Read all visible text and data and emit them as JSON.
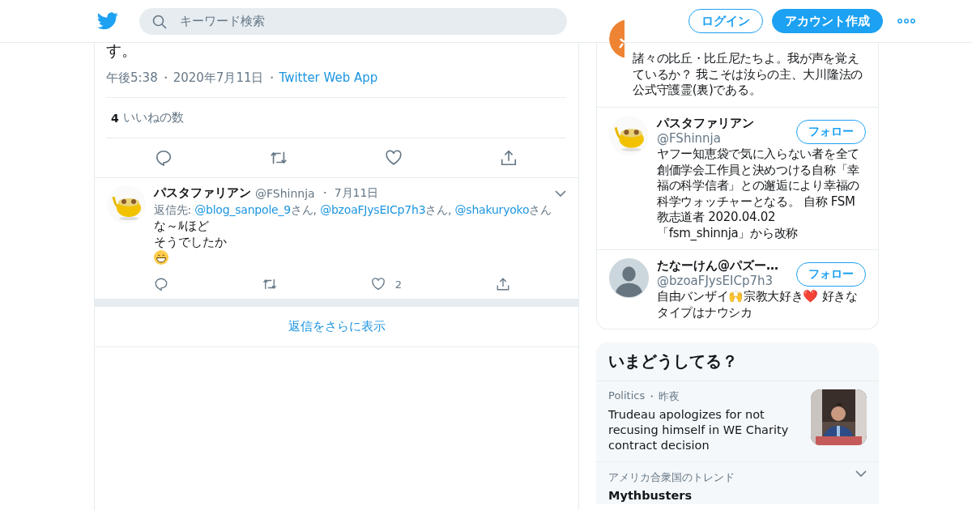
{
  "header": {
    "search": {
      "placeholder": "キーワード検索"
    },
    "login": "ログイン",
    "signup": "アカウント作成"
  },
  "tweet": {
    "text_tail": "す。",
    "time": "午後5:38",
    "separator": "・",
    "date": "2020年7月11日",
    "source": "Twitter Web App",
    "likes_count": "4",
    "likes_label": "いいねの数"
  },
  "reply": {
    "name": "パスタファリアン",
    "handle": "@FShinnja",
    "separator": "・",
    "date": "7月11日",
    "reply_to_label": "返信先:",
    "reply_to": [
      {
        "handle": "@blog_sanpole_9",
        "suffix": "さん,"
      },
      {
        "handle": "@bzoaFJysEICp7h3",
        "suffix": "さん,"
      },
      {
        "handle": "@shakuryoko",
        "suffix": "さん"
      }
    ],
    "lines": [
      "な～ﾙほど",
      "そうでしたか"
    ],
    "like_count": "2"
  },
  "show_more": "返信をさらに表示",
  "who_to_follow": [
    {
      "kind": "partial",
      "bio": "諸々の比丘・比丘尼たちよ。我が声を覚えているか？ 我こそは汝らの主、大川隆法の公式守護霊(裏)である。"
    },
    {
      "kind": "full",
      "name": "パスタファリアン",
      "handle": "@FShinnja",
      "follow": "フォロー",
      "bio": "ヤフー知恵袋で気に入らない者を全て創価学会工作員と決めつける自称「幸福の科学信者」との邂逅により幸福の科学ウォッチャーとなる。 自称 FSM教志道者 2020.04.02 「fsm_shinnja」から改称"
    },
    {
      "kind": "full",
      "avatar": {
        "kind": "default"
      },
      "name": "たなーけん@パズー…",
      "handle": "@bzoaFJysEICp7h3",
      "follow": "フォロー",
      "bio": "自由バンザイ🙌宗教大好き❤️ 好きなタイプはナウシカ"
    }
  ],
  "trends": {
    "title": "いまどうしてる？",
    "items": [
      {
        "kind": "news",
        "category": "Politics",
        "separator": "・",
        "time": "昨夜",
        "headline": "Trudeau apologizes for not recusing himself in WE Charity contract decision"
      },
      {
        "kind": "trend",
        "category": "アメリカ合衆国のトレンド",
        "name": "Mythbusters"
      }
    ]
  }
}
